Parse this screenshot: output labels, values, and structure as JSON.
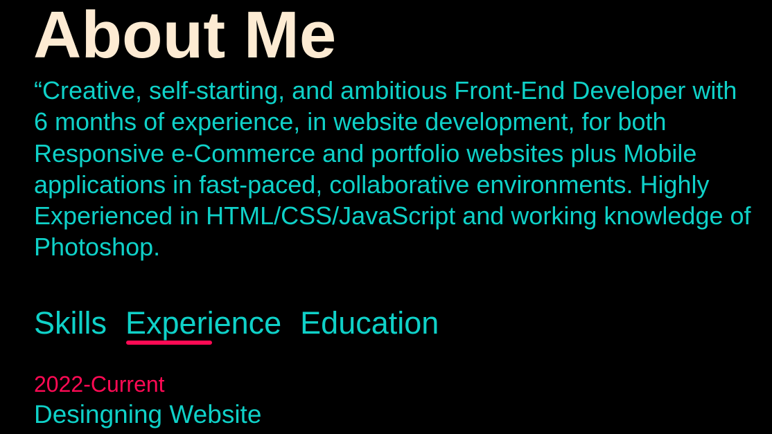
{
  "about": {
    "title": "About Me",
    "bio": "“Creative, self-starting, and ambitious Front-End Developer with 6 months of experience, in website development, for both Responsive e-Commerce and portfolio websites plus Mobile applications in fast-paced, collaborative environments. Highly Experienced in HTML/CSS/JavaScript and working knowledge of Photoshop."
  },
  "tabs": {
    "skills": "Skills",
    "experience": "Experience",
    "education": "Education",
    "active": "Experience"
  },
  "experience": {
    "entries": [
      {
        "date": "2022-Current",
        "title": "Desingning Website"
      }
    ]
  },
  "colors": {
    "background": "#000000",
    "title": "#fdebd3",
    "text": "#0fd1c8",
    "accent": "#ff0a54"
  }
}
